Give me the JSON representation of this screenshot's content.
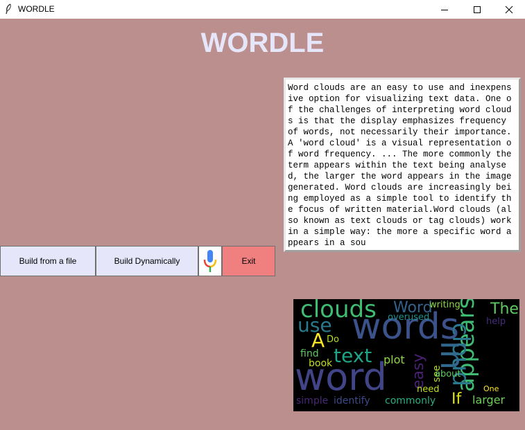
{
  "window": {
    "title": "WORDLE",
    "controls": {
      "minimize": "—",
      "maximize": "☐",
      "close": "✕"
    }
  },
  "heading": "WORDLE",
  "text_area": {
    "content": "Word clouds are an easy to use and inexpensive option for visualizing text data. One of the challenges of interpreting word clouds is that the display emphasizes frequency of words, not necessarily their importance.A 'word cloud' is a visual representation of word frequency. ... The more commonly the term appears within the text being analysed, the larger the word appears in the image generated. Word clouds are increasingly being employed as a simple tool to identify the focus of written material.Word clouds (also known as text clouds or tag clouds) work in a simple way: the more a specific word appears in a sou"
  },
  "buttons": {
    "build_file": "Build from a file",
    "build_dynamic": "Build Dynamically",
    "mic_icon": "microphone-icon",
    "exit": "Exit"
  },
  "word_cloud": {
    "words": [
      "clouds",
      "Word",
      "writing",
      "The",
      "use",
      "words",
      "overused",
      "help",
      "A",
      "Do",
      "appears",
      "text",
      "cloud",
      "find",
      "plot",
      "book",
      "easy",
      "word",
      "in",
      "see",
      "about",
      "need",
      "If",
      "simple",
      "identify",
      "commonly",
      "larger",
      "One"
    ]
  },
  "colors": {
    "background": "#bc8f8f",
    "heading": "#e6e6fa",
    "button": "#e6e6fa",
    "exit": "#f08080"
  }
}
